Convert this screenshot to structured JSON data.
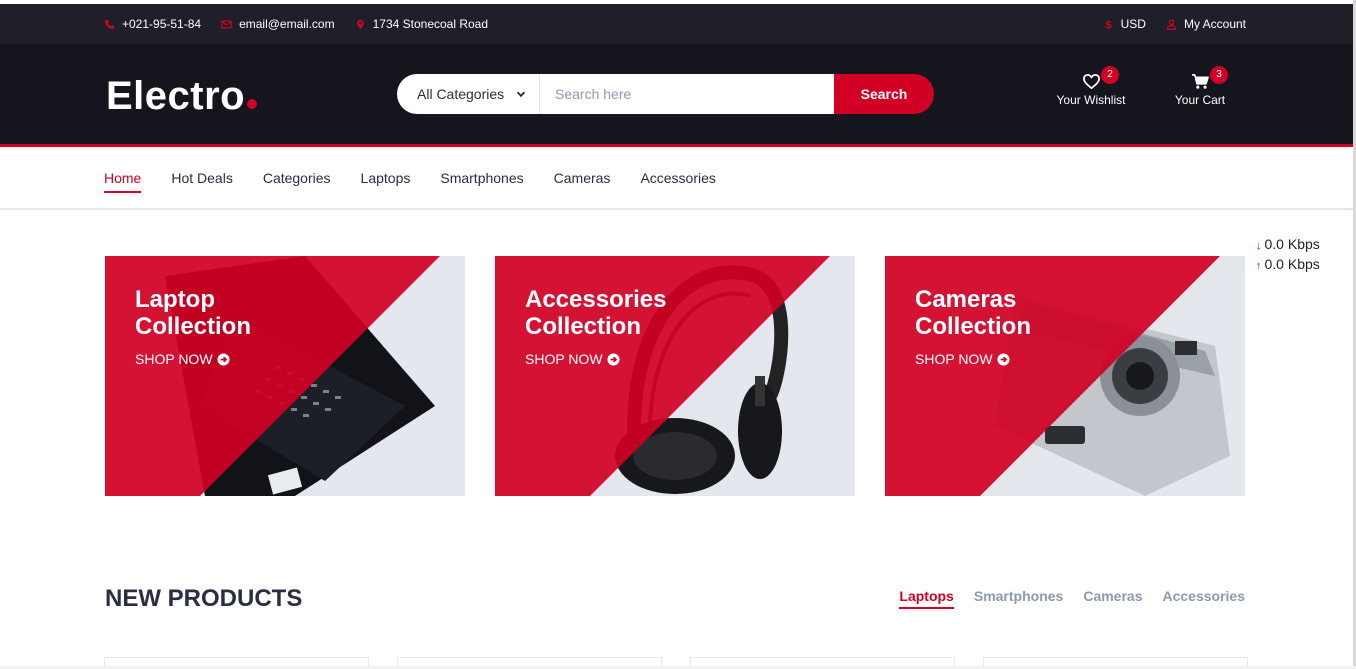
{
  "top_header": {
    "phone": "+021-95-51-84",
    "email": "email@email.com",
    "address": "1734 Stonecoal Road",
    "currency": "USD",
    "account": "My Account"
  },
  "header": {
    "logo": "Electro",
    "search": {
      "category": "All Categories",
      "placeholder": "Search here",
      "button": "Search"
    },
    "wishlist": {
      "label": "Your Wishlist",
      "count": "2"
    },
    "cart": {
      "label": "Your Cart",
      "count": "3"
    }
  },
  "nav": {
    "items": [
      {
        "label": "Home",
        "active": true
      },
      {
        "label": "Hot Deals"
      },
      {
        "label": "Categories"
      },
      {
        "label": "Laptops"
      },
      {
        "label": "Smartphones"
      },
      {
        "label": "Cameras"
      },
      {
        "label": "Accessories"
      }
    ]
  },
  "speed": {
    "down": "0.0 Kbps",
    "up": "0.0 Kbps"
  },
  "collections": [
    {
      "title_line1": "Laptop",
      "title_line2": "Collection",
      "cta": "SHOP NOW",
      "image": "laptop"
    },
    {
      "title_line1": "Accessories",
      "title_line2": "Collection",
      "cta": "SHOP NOW",
      "image": "headphones"
    },
    {
      "title_line1": "Cameras",
      "title_line2": "Collection",
      "cta": "SHOP NOW",
      "image": "camera"
    }
  ],
  "new_products": {
    "title": "NEW PRODUCTS",
    "tabs": [
      {
        "label": "Laptops",
        "active": true
      },
      {
        "label": "Smartphones"
      },
      {
        "label": "Cameras"
      },
      {
        "label": "Accessories"
      }
    ]
  },
  "colors": {
    "accent": "#d10024",
    "dark": "#15161d",
    "topbar": "#1e1f29",
    "muted": "#8d99ae"
  },
  "icons": {
    "phone": "phone-icon",
    "email": "envelope-icon",
    "address": "map-marker-icon",
    "currency": "dollar-icon",
    "account": "user-icon",
    "wishlist": "heart-icon",
    "cart": "cart-icon",
    "shop_now": "arrow-circle-right-icon"
  }
}
